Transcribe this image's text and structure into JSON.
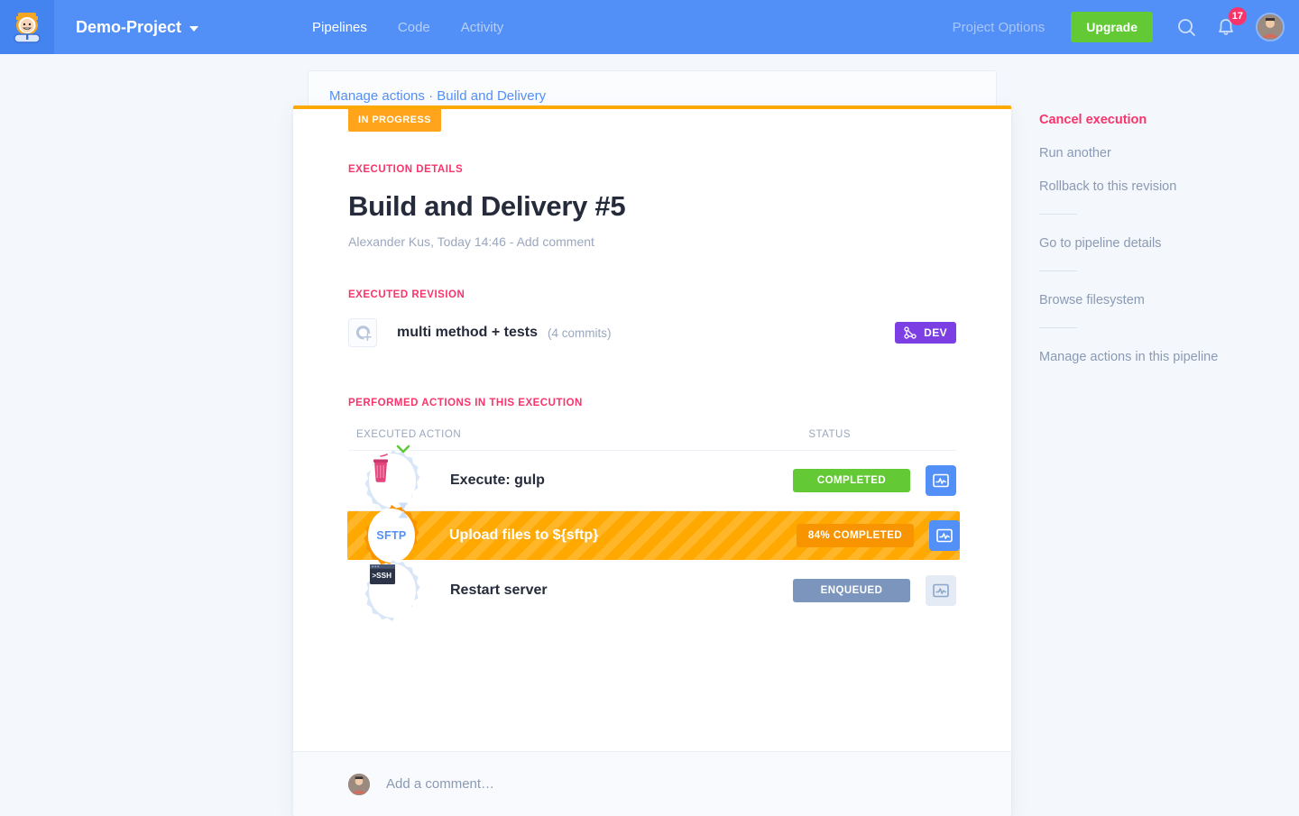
{
  "topbar": {
    "logo_alt": "buddy-mascot-logo",
    "project_name": "Demo-Project",
    "nav": [
      {
        "label": "Pipelines",
        "active": true
      },
      {
        "label": "Code",
        "active": false
      },
      {
        "label": "Activity",
        "active": false
      }
    ],
    "project_options": "Project Options",
    "upgrade_label": "Upgrade",
    "notification_count": "17",
    "accent_blue": "#5290f7",
    "upgrade_green": "#63ca36",
    "badge_pink": "#f9346b"
  },
  "breadcrumb": {
    "root": "Manage actions",
    "separator": " · ",
    "current": "Build and Delivery",
    "full": "Manage actions · Build and Delivery"
  },
  "execution": {
    "status_chip": "IN PROGRESS",
    "status_chip_color": "#ffa41b",
    "details_label": "EXECUTION DETAILS",
    "title": "Build and Delivery #5",
    "author": "Alexander Kus",
    "time": "Today 14:46",
    "meta_separator": ", ",
    "meta_dash": " - ",
    "add_comment_link": "Add comment",
    "meta_full": "Alexander Kus, Today 14:46 - Add comment"
  },
  "revision": {
    "label": "EXECUTED REVISION",
    "icon": "commit-avatar-icon",
    "name": "multi method + tests",
    "commits": "(4 commits)",
    "branch_badge": "DEV",
    "branch_badge_color": "#7c3fe4"
  },
  "actions": {
    "label": "PERFORMED ACTIONS IN THIS EXECUTION",
    "columns": {
      "action": "EXECUTED ACTION",
      "status": "STATUS"
    },
    "rows": [
      {
        "icon": "gulp-cup-icon",
        "icon_text": "",
        "name": "Execute: gulp",
        "status": "COMPLETED",
        "status_color": "#63ca36",
        "log_button": "logs-icon",
        "highlighted": false,
        "connector_below": "chevron-down-icon"
      },
      {
        "icon": "sftp-icon",
        "icon_text": "SFTP",
        "name": "Upload files to ${sftp}",
        "status": "84% COMPLETED",
        "status_color": "#f79400",
        "log_button": "logs-icon",
        "highlighted": true,
        "connector_below": "hourglass-icon"
      },
      {
        "icon": "ssh-terminal-icon",
        "icon_text": "SSH",
        "name": "Restart server",
        "status": "ENQUEUED",
        "status_color": "#7b95bd",
        "log_button": "logs-icon",
        "highlighted": false,
        "connector_below": ""
      }
    ]
  },
  "comment_box": {
    "avatar": "user-avatar",
    "placeholder": "Add a comment…"
  },
  "sidebar": {
    "groups": [
      {
        "items": [
          {
            "label": "Cancel execution",
            "style": "danger"
          },
          {
            "label": "Run another",
            "style": "normal"
          },
          {
            "label": "Rollback to this revision",
            "style": "normal"
          }
        ]
      },
      {
        "items": [
          {
            "label": "Go to pipeline details",
            "style": "normal"
          }
        ]
      },
      {
        "items": [
          {
            "label": "Browse filesystem",
            "style": "normal"
          }
        ]
      },
      {
        "items": [
          {
            "label": "Manage actions in this pipeline",
            "style": "normal"
          }
        ]
      }
    ]
  }
}
